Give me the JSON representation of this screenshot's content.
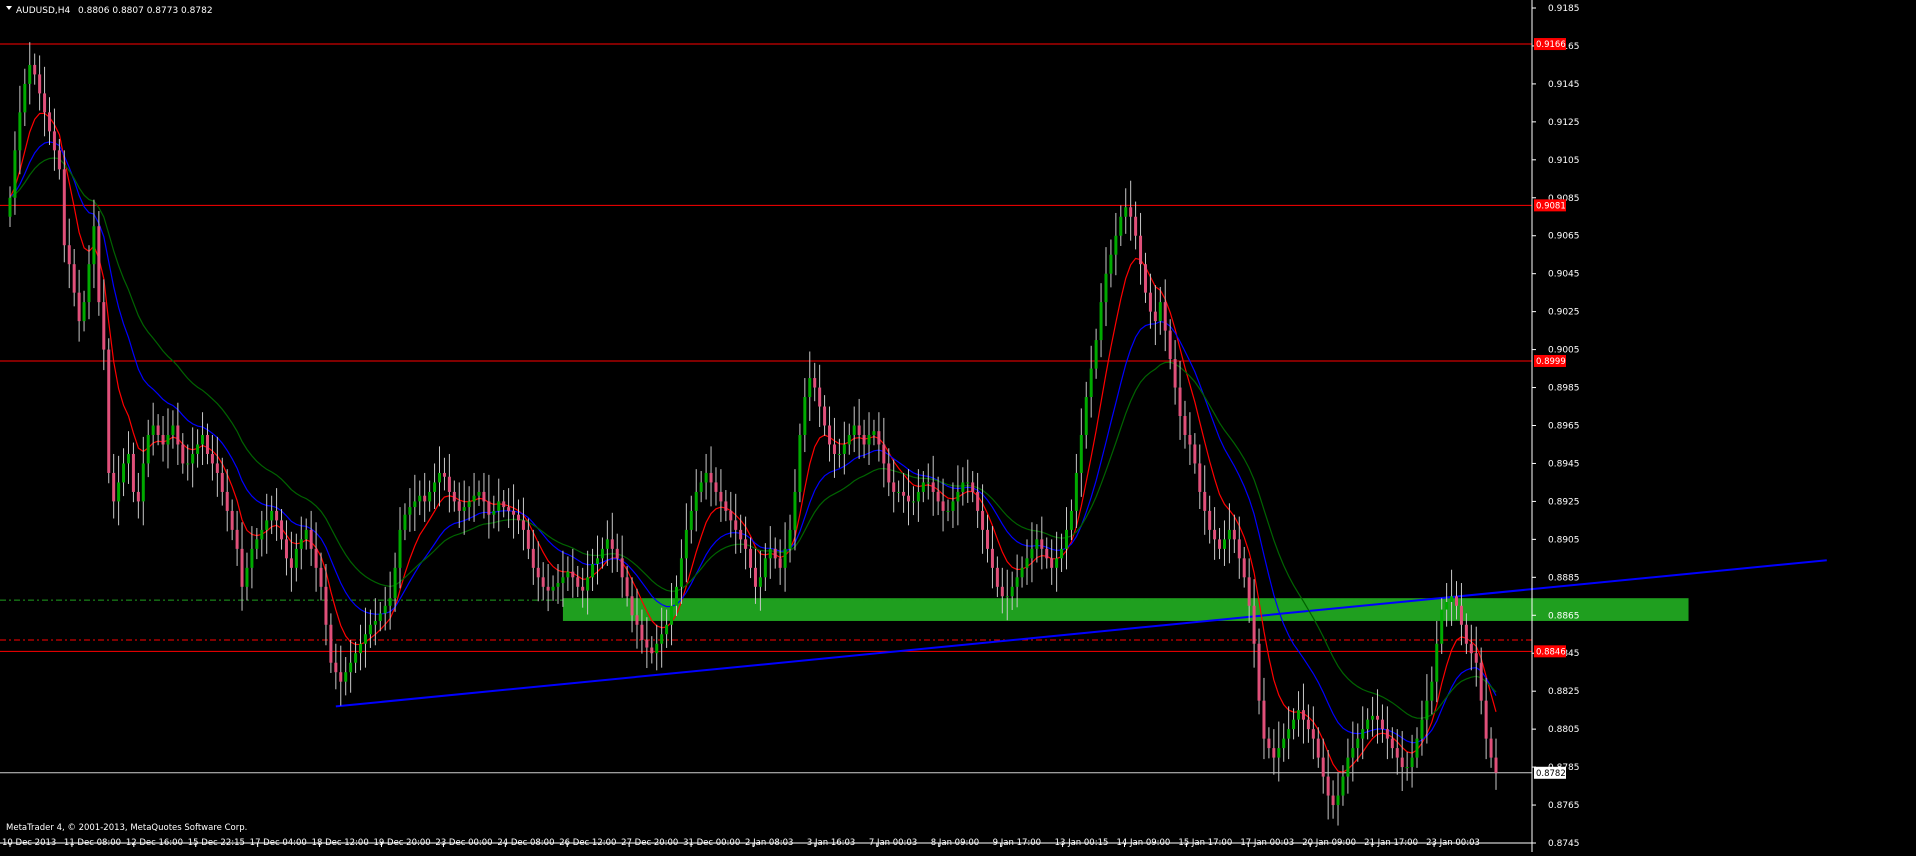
{
  "header": {
    "symbol_label": "AUDUSD,H4",
    "ohlc_text": "0.8806 0.8807 0.8773 0.8782"
  },
  "footer": {
    "copyright": "MetaTrader 4, © 2001-2013, MetaQuotes Software Corp."
  },
  "colors": {
    "background": "#000000",
    "bull": "#00aa00",
    "bear": "#e0507a",
    "wick": "#c8c8c8",
    "ma_fast": "#ff0000",
    "ma_mid": "#0000ff",
    "ma_slow": "#006400",
    "level": "#ff0000",
    "zone": "#1f9f1f",
    "trend": "#0000ff",
    "text": "#ffffff"
  },
  "chart_data": {
    "type": "candlestick",
    "ylim": [
      0.8745,
      0.9185
    ],
    "y_ticks": [
      "0.9185",
      "0.9165",
      "0.9145",
      "0.9125",
      "0.9105",
      "0.9085",
      "0.9065",
      "0.9045",
      "0.9025",
      "0.9005",
      "0.8985",
      "0.8965",
      "0.8945",
      "0.8925",
      "0.8905",
      "0.8885",
      "0.8865",
      "0.8845",
      "0.8825",
      "0.8805",
      "0.8785",
      "0.8765",
      "0.8745"
    ],
    "x_ticks": [
      "10 Dec 2013",
      "11 Dec 08:00",
      "12 Dec 16:00",
      "15 Dec 22:15",
      "17 Dec 04:00",
      "18 Dec 12:00",
      "19 Dec 20:00",
      "23 Dec 00:00",
      "24 Dec 08:00",
      "26 Dec 12:00",
      "27 Dec 20:00",
      "31 Dec 00:00",
      "2 Jan 08:03",
      "3 Jan 16:03",
      "7 Jan 00:03",
      "8 Jan 09:00",
      "9 Jan 17:00",
      "13 Jan 00:15",
      "14 Jan 09:00",
      "15 Jan 17:00",
      "17 Jan 00:03",
      "20 Jan 09:00",
      "21 Jan 17:00",
      "23 Jan 00:03"
    ],
    "current_price": {
      "value": 0.8782,
      "label": "0.8782"
    },
    "levels": [
      {
        "value": 0.9166,
        "label": "0.9166"
      },
      {
        "value": 0.9081,
        "label": "0.9081"
      },
      {
        "value": 0.8999,
        "label": "0.8999"
      },
      {
        "value": 0.8846,
        "label": "0.8846"
      }
    ],
    "dash_levels": [
      0.8873,
      0.8852
    ],
    "zone": {
      "from_bar": 112,
      "to_bar": 340,
      "low": 0.8862,
      "high": 0.8874
    },
    "trendline": {
      "bar1": 66,
      "price1": 0.8817,
      "bar2": 368,
      "price2": 0.8894
    },
    "closes": [
      0.9085,
      0.911,
      0.913,
      0.9145,
      0.9155,
      0.915,
      0.914,
      0.913,
      0.912,
      0.911,
      0.91,
      0.906,
      0.905,
      0.9035,
      0.902,
      0.903,
      0.905,
      0.907,
      0.903,
      0.9005,
      0.894,
      0.8925,
      0.8935,
      0.8945,
      0.895,
      0.893,
      0.8925,
      0.8945,
      0.896,
      0.8965,
      0.896,
      0.8955,
      0.896,
      0.8965,
      0.8955,
      0.8945,
      0.8945,
      0.895,
      0.8955,
      0.896,
      0.895,
      0.8945,
      0.894,
      0.893,
      0.892,
      0.891,
      0.89,
      0.888,
      0.889,
      0.89,
      0.8905,
      0.891,
      0.8915,
      0.892,
      0.8915,
      0.8905,
      0.8895,
      0.889,
      0.89,
      0.8905,
      0.891,
      0.89,
      0.889,
      0.888,
      0.886,
      0.884,
      0.8835,
      0.883,
      0.8835,
      0.884,
      0.8845,
      0.885,
      0.8855,
      0.886,
      0.8862,
      0.8866,
      0.887,
      0.8874,
      0.889,
      0.891,
      0.8918,
      0.8922,
      0.8925,
      0.8928,
      0.8925,
      0.893,
      0.8935,
      0.894,
      0.8938,
      0.893,
      0.8925,
      0.892,
      0.8922,
      0.8925,
      0.8928,
      0.893,
      0.8925,
      0.8918,
      0.892,
      0.8925,
      0.8922,
      0.892,
      0.8918,
      0.8915,
      0.891,
      0.89,
      0.889,
      0.8885,
      0.888,
      0.8878,
      0.888,
      0.8882,
      0.8885,
      0.8888,
      0.8885,
      0.888,
      0.8878,
      0.8885,
      0.8892,
      0.8895,
      0.89,
      0.8905,
      0.89,
      0.8895,
      0.8885,
      0.8875,
      0.8865,
      0.886,
      0.8852,
      0.8848,
      0.8845,
      0.885,
      0.8855,
      0.886,
      0.887,
      0.888,
      0.8895,
      0.891,
      0.892,
      0.893,
      0.8935,
      0.894,
      0.8935,
      0.893,
      0.8925,
      0.892,
      0.8915,
      0.891,
      0.8905,
      0.89,
      0.889,
      0.888,
      0.8885,
      0.8895,
      0.89,
      0.8895,
      0.889,
      0.89,
      0.891,
      0.893,
      0.896,
      0.898,
      0.899,
      0.8985,
      0.8975,
      0.8965,
      0.8955,
      0.895,
      0.895,
      0.8955,
      0.896,
      0.8965,
      0.896,
      0.8955,
      0.896,
      0.8962,
      0.8955,
      0.8945,
      0.8935,
      0.893,
      0.893,
      0.8928,
      0.8925,
      0.8925,
      0.893,
      0.8935,
      0.8935,
      0.893,
      0.8925,
      0.892,
      0.892,
      0.8925,
      0.893,
      0.8935,
      0.8935,
      0.893,
      0.892,
      0.891,
      0.89,
      0.889,
      0.888,
      0.8875,
      0.8875,
      0.888,
      0.8885,
      0.889,
      0.8895,
      0.89,
      0.8905,
      0.89,
      0.8895,
      0.889,
      0.8895,
      0.89,
      0.891,
      0.892,
      0.894,
      0.896,
      0.898,
      0.8995,
      0.901,
      0.903,
      0.9045,
      0.9055,
      0.9065,
      0.9075,
      0.908,
      0.9075,
      0.9065,
      0.905,
      0.9035,
      0.9025,
      0.902,
      0.903,
      0.9015,
      0.9,
      0.8985,
      0.897,
      0.896,
      0.8955,
      0.8945,
      0.893,
      0.892,
      0.891,
      0.8905,
      0.89,
      0.8905,
      0.891,
      0.8905,
      0.8895,
      0.8885,
      0.887,
      0.885,
      0.882,
      0.88,
      0.8795,
      0.879,
      0.8795,
      0.88,
      0.8805,
      0.881,
      0.8815,
      0.881,
      0.8805,
      0.88,
      0.879,
      0.878,
      0.877,
      0.8765,
      0.877,
      0.878,
      0.879,
      0.8795,
      0.88,
      0.8805,
      0.881,
      0.8812,
      0.881,
      0.8805,
      0.88,
      0.8795,
      0.879,
      0.8785,
      0.8785,
      0.879,
      0.88,
      0.881,
      0.882,
      0.883,
      0.885,
      0.8868,
      0.8872,
      0.8875,
      0.887,
      0.886,
      0.885,
      0.8845,
      0.884,
      0.882,
      0.88,
      0.879,
      0.8782
    ]
  }
}
